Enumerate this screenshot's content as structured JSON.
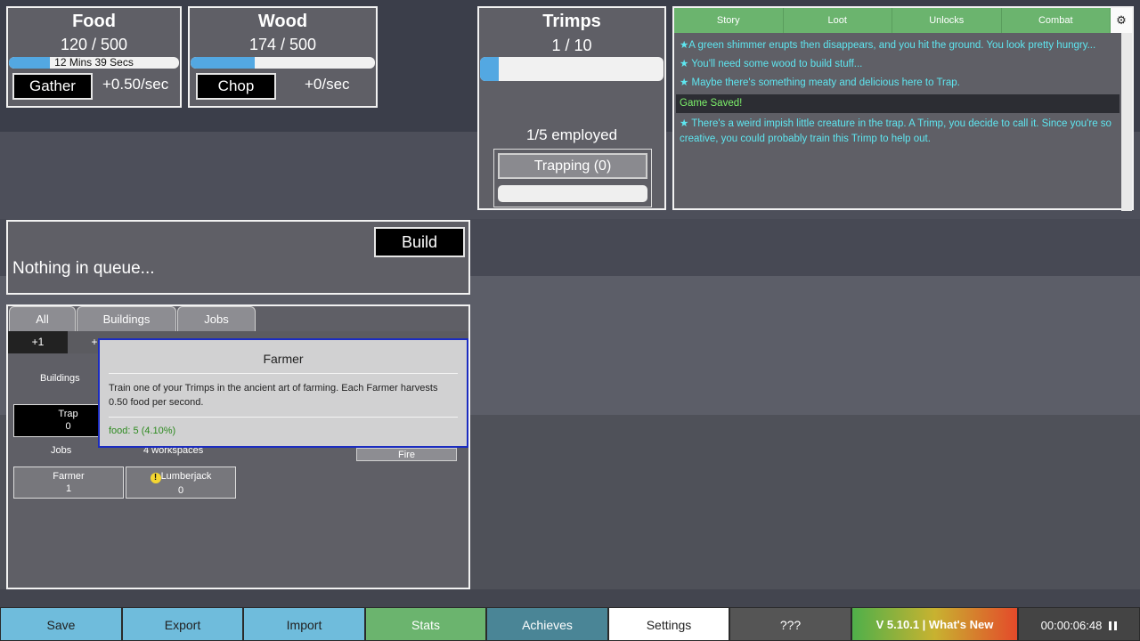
{
  "resources": {
    "food": {
      "title": "Food",
      "count": "120 / 500",
      "progress": 0.24,
      "bar_text": "12 Mins 39 Secs",
      "button": "Gather",
      "rate": "+0.50/sec"
    },
    "wood": {
      "title": "Wood",
      "count": "174 / 500",
      "progress": 0.35,
      "bar_text": "",
      "button": "Chop",
      "rate": "+0/sec"
    }
  },
  "trimps": {
    "title": "Trimps",
    "count": "1 / 10",
    "progress": 0.1,
    "employed": "1/5 employed",
    "trapping_button": "Trapping (0)",
    "trapping_progress": 0
  },
  "log": {
    "tabs": [
      "Story",
      "Loot",
      "Unlocks",
      "Combat"
    ],
    "settings_icon": "gear-icon",
    "entries": [
      {
        "text": "★A green shimmer erupts then disappears, and you hit the ground. You look pretty hungry..."
      },
      {
        "text": "★ You'll need some wood to build stuff..."
      },
      {
        "text": "★ Maybe there's something meaty and delicious here to Trap."
      },
      {
        "text": "Game Saved!"
      },
      {
        "text": "★ There's a weird impish little creature in the trap. A Trimp, you decide to call it. Since you're so creative, you could probably train this Trimp to help out."
      }
    ],
    "colors": {
      "story": "#5ee6f0",
      "saved": "#7df06b"
    }
  },
  "queue": {
    "build_button": "Build",
    "status": "Nothing in queue..."
  },
  "buy": {
    "tabs": [
      "All",
      "Buildings",
      "Jobs"
    ],
    "amounts": [
      "+1",
      "+"
    ],
    "buildings_label": "Buildings",
    "trap": {
      "name": "Trap",
      "count": "0"
    },
    "jobs_label": "Jobs",
    "workspaces": "4 workspaces",
    "fire_button": "Fire",
    "jobs": [
      {
        "name": "Farmer",
        "count": "1"
      },
      {
        "name": "Lumberjack",
        "count": "0"
      }
    ]
  },
  "tooltip": {
    "title": "Farmer",
    "text": "Train one of your Trimps in the ancient art of farming. Each Farmer harvests 0.50 food per second.",
    "cost": "food: 5 (4.10%)"
  },
  "footer": {
    "save": "Save",
    "export": "Export",
    "import": "Import",
    "stats": "Stats",
    "achieves": "Achieves",
    "settings": "Settings",
    "unknown": "???",
    "version": "V 5.10.1 | What's New",
    "time": "00:00:06:48"
  }
}
